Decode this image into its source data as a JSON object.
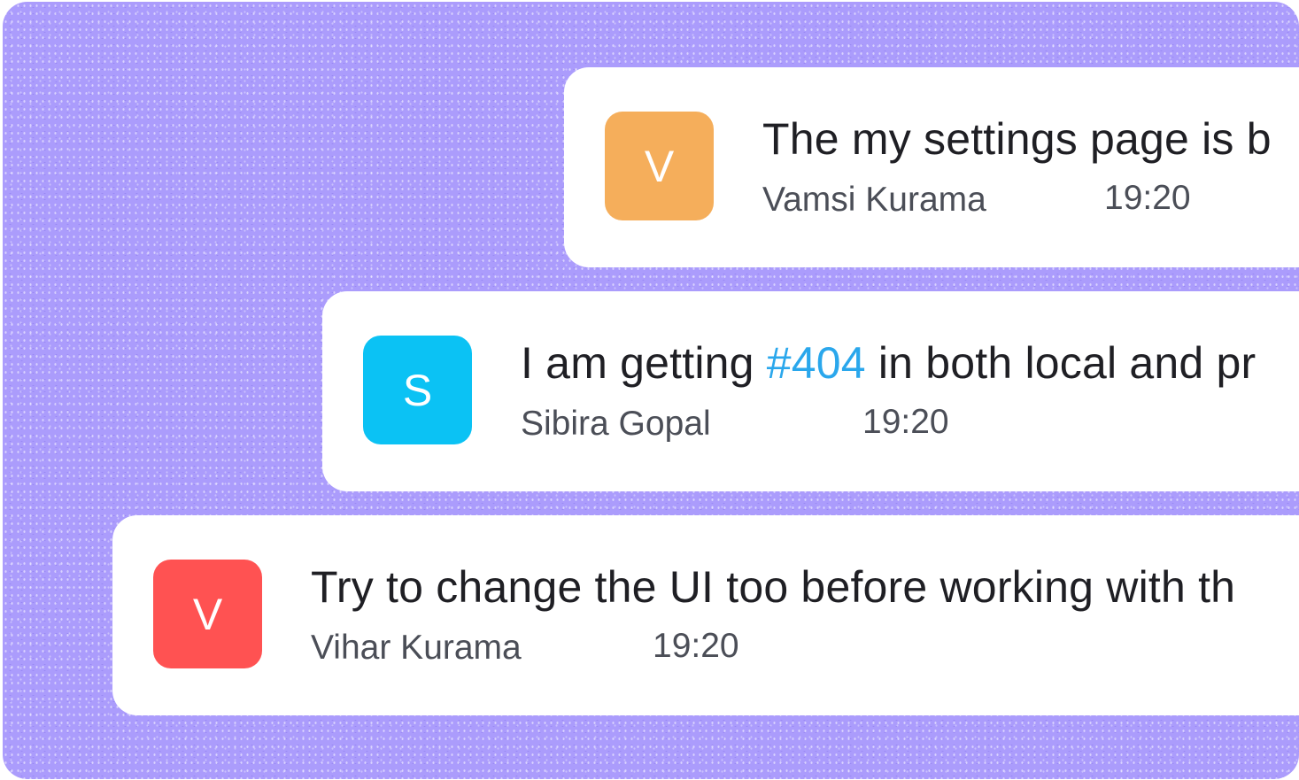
{
  "colors": {
    "background": "#ab9cfc",
    "card": "#ffffff",
    "link": "#2aa7ec"
  },
  "messages": [
    {
      "avatar": {
        "initial": "V",
        "color": "#f5ae5b"
      },
      "text": "The my settings page is b",
      "author": "Vamsi Kurama",
      "time": "19:20"
    },
    {
      "avatar": {
        "initial": "S",
        "color": "#0bc2f4"
      },
      "text_before": "I am getting ",
      "tag": "#404",
      "text_after": " in both local and pr",
      "author": "Sibira Gopal",
      "time": "19:20"
    },
    {
      "avatar": {
        "initial": "V",
        "color": "#ff5252"
      },
      "text": "Try to change the UI too before working with th",
      "author": "Vihar Kurama",
      "time": "19:20"
    }
  ]
}
